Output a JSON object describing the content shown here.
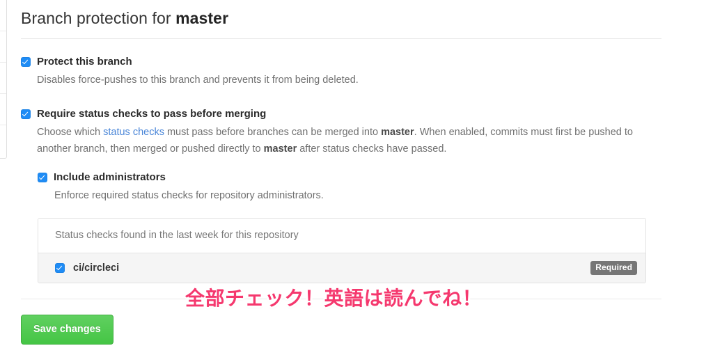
{
  "page": {
    "title_prefix": "Branch protection for ",
    "branch": "master"
  },
  "options": {
    "protect": {
      "label": "Protect this branch",
      "description": "Disables force-pushes to this branch and prevents it from being deleted.",
      "checked": true
    },
    "require_status_checks": {
      "label": "Require status checks to pass before merging",
      "desc_part1": "Choose which ",
      "desc_link": "status checks",
      "desc_part2": " must pass before branches can be merged into ",
      "desc_branch1": "master",
      "desc_part3": ". When enabled, commits must first be pushed to another branch, then merged or pushed directly to ",
      "desc_branch2": "master",
      "desc_part4": " after status checks have passed.",
      "checked": true
    },
    "include_administrators": {
      "label": "Include administrators",
      "description": "Enforce required status checks for repository administrators.",
      "checked": true
    }
  },
  "status_checks_panel": {
    "header": "Status checks found in the last week for this repository",
    "rows": [
      {
        "name": "ci/circleci",
        "badge": "Required",
        "checked": true
      }
    ]
  },
  "footer": {
    "save_label": "Save changes"
  },
  "annotation": {
    "text": "全部チェック！英語は読んでね！"
  },
  "colors": {
    "checkbox_blue": "#1f8cf5",
    "link_blue": "#4a86d8",
    "badge_gray": "#767676",
    "save_green": "#45c545",
    "annotation_pink": "#f5386e"
  }
}
